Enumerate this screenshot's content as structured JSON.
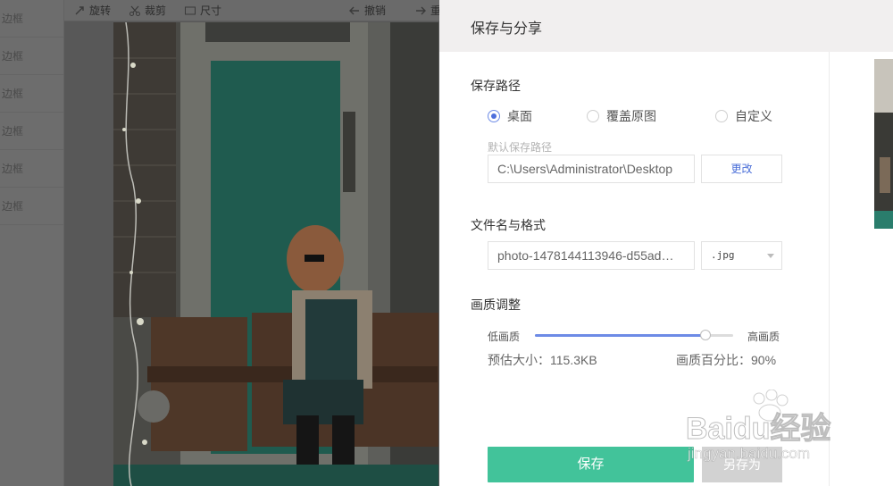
{
  "sidebar": {
    "items": [
      {
        "label": "边框"
      },
      {
        "label": "边框"
      },
      {
        "label": "边框"
      },
      {
        "label": "边框"
      },
      {
        "label": "边框"
      },
      {
        "label": "边框"
      }
    ]
  },
  "toolbar": {
    "rotate_label": "旋转",
    "crop_label": "裁剪",
    "size_label": "尺寸",
    "undo_label": "撤销",
    "redo_label": "重"
  },
  "dialog": {
    "title": "保存与分享",
    "save_path": {
      "title": "保存路径",
      "options": [
        {
          "label": "桌面",
          "checked": true
        },
        {
          "label": "覆盖原图",
          "checked": false
        },
        {
          "label": "自定义",
          "checked": false
        }
      ],
      "hint": "默认保存路径",
      "path_value": "C:\\Users\\Administrator\\Desktop",
      "change_label": "更改"
    },
    "file": {
      "title": "文件名与格式",
      "filename_value": "photo-1478144113946-d55ad…",
      "format_value": ".jpg"
    },
    "quality": {
      "title": "画质调整",
      "low_label": "低画质",
      "high_label": "高画质",
      "level": 0.86,
      "estimate_text": "预估大小：115.3KB",
      "percent_text": "画质百分比：90%"
    },
    "save_label": "保存",
    "save_as_label": "另存为"
  },
  "watermark": {
    "brand": "Baidu经验",
    "url": "jingyan.baidu.com"
  },
  "colors": {
    "accent_blue": "#4e6fdc",
    "save_green": "#42c39a",
    "overlay": "#5b5b5b"
  }
}
